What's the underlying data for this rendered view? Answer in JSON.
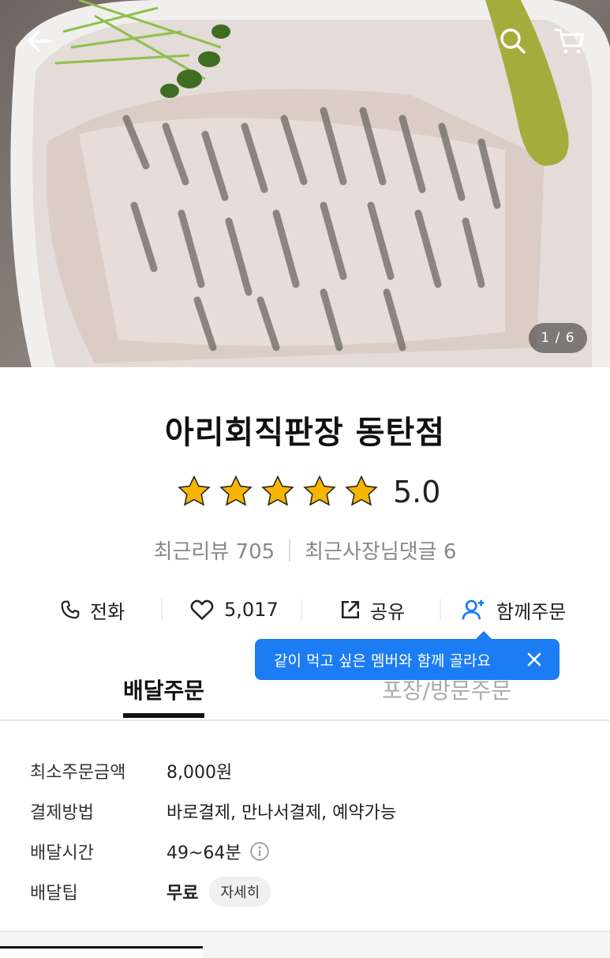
{
  "gallery": {
    "counter": "1 / 6"
  },
  "store": {
    "name": "아리회직판장 동탄점",
    "rating": "5.0",
    "stars": 5
  },
  "meta": {
    "recent_reviews": "최근리뷰 705",
    "owner_replies": "최근사장님댓글 6"
  },
  "actions": {
    "call": "전화",
    "like": "5,017",
    "share": "공유",
    "group_order": "함께주문"
  },
  "tooltip": {
    "text": "같이 먹고 싶은 멤버와 함께 골라요"
  },
  "tabs": {
    "delivery": "배달주문",
    "pickup": "포장/방문주문"
  },
  "info": [
    {
      "label": "최소주문금액",
      "value": "8,000원"
    },
    {
      "label": "결제방법",
      "value": "바로결제, 만나서결제, 예약가능"
    },
    {
      "label": "배달시간",
      "value": "49~64분"
    },
    {
      "label": "배달팁",
      "value": "무료",
      "detail": "자세히"
    }
  ],
  "colors": {
    "accent": "#1c7cf4",
    "star": "#f7b500"
  }
}
